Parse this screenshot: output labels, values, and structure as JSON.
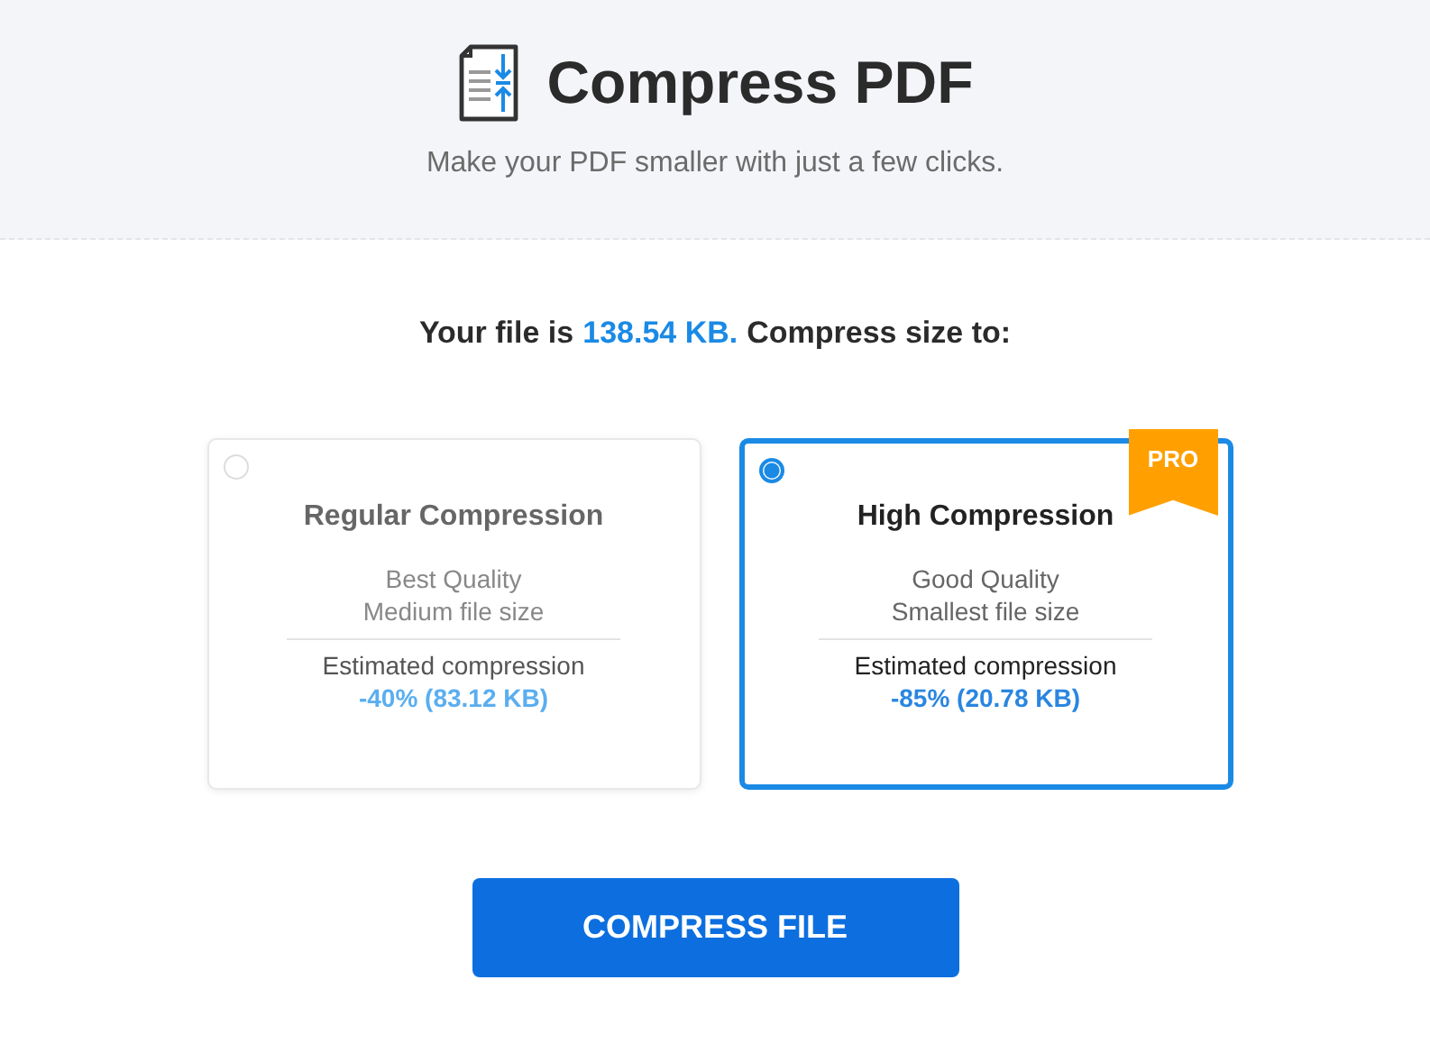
{
  "header": {
    "title": "Compress PDF",
    "subtitle": "Make your PDF smaller with just a few clicks."
  },
  "file_info": {
    "prefix": "Your file is",
    "size": "138.54 KB.",
    "suffix": "Compress size to:"
  },
  "options": [
    {
      "title": "Regular Compression",
      "quality": "Best Quality",
      "size_note": "Medium file size",
      "estimate_label": "Estimated compression",
      "estimate": "-40% (83.12 KB)",
      "selected": false
    },
    {
      "title": "High Compression",
      "quality": "Good Quality",
      "size_note": "Smallest file size",
      "estimate_label": "Estimated compression",
      "estimate": "-85% (20.78 KB)",
      "selected": true,
      "badge": "PRO"
    }
  ],
  "action_button": "COMPRESS FILE"
}
